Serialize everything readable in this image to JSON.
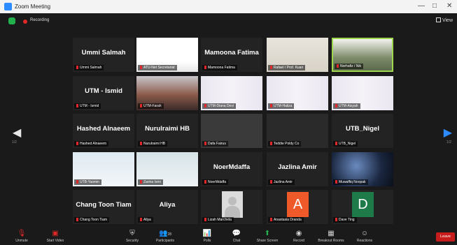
{
  "window": {
    "title": "Zoom Meeting",
    "minimize": "—",
    "maximize": "□",
    "close": "✕"
  },
  "status": {
    "recording": "Recording",
    "view": "View"
  },
  "nav": {
    "prev_page": "1/2",
    "next_page": "1/2"
  },
  "tiles": [
    {
      "name": "Ummi Salmah",
      "label": "Ummi Salmah",
      "type": "name"
    },
    {
      "name": "",
      "label": "ATU-Net Secretariat",
      "type": "video"
    },
    {
      "name": "Mamoona Fatima",
      "label": "Mamoona Fatima",
      "type": "name"
    },
    {
      "name": "",
      "label": "Rafael / Prof. Kuan",
      "type": "video"
    },
    {
      "name": "",
      "label": "Norhafiz / Nik",
      "type": "video"
    },
    {
      "name": "UTM - Ismid",
      "label": "UTM - Ismid",
      "type": "name"
    },
    {
      "name": "",
      "label": "UTM-Farah",
      "type": "video"
    },
    {
      "name": "",
      "label": "UTM-Diana Devi",
      "type": "video"
    },
    {
      "name": "",
      "label": "UTM-Haliza",
      "type": "video"
    },
    {
      "name": "",
      "label": "UTM-Aisyah",
      "type": "video"
    },
    {
      "name": "Hashed Alnaeem",
      "label": "Hashed Alnaeem",
      "type": "name"
    },
    {
      "name": "Nurulraimi HB",
      "label": "Nurulraimi HB",
      "type": "name"
    },
    {
      "name": "",
      "label": "Dafa Fairus",
      "type": "video"
    },
    {
      "name": "",
      "label": "Teddie Poldy Co",
      "type": "video"
    },
    {
      "name": "UTB_Nigel",
      "label": "UTB_Nigel",
      "type": "name"
    },
    {
      "name": "",
      "label": "UTB-Yasmin",
      "type": "video"
    },
    {
      "name": "",
      "label": "Zarina Ismi",
      "type": "video"
    },
    {
      "name": "NoerMdaffa",
      "label": "NoerMdaffa",
      "type": "name"
    },
    {
      "name": "Jazlina Amir",
      "label": "Jazlina Amir",
      "type": "name"
    },
    {
      "name": "",
      "label": "Muwaffiq Noopak",
      "type": "video"
    },
    {
      "name": "Chang Toon Tiam",
      "label": "Chang Toon Tiam",
      "type": "name"
    },
    {
      "name": "Aliya",
      "label": "Aliya",
      "type": "name"
    },
    {
      "name": "",
      "label": "Lizah Marchela",
      "type": "avatar"
    },
    {
      "name": "",
      "label": "Anastasia Dranda",
      "letter": "A",
      "color": "#f05a2b",
      "type": "letter"
    },
    {
      "name": "",
      "label": "Dave Ting",
      "letter": "D",
      "color": "#1f7a4a",
      "type": "letter"
    }
  ],
  "toolbar": {
    "unmute": "Unmute",
    "start_video": "Start Video",
    "security": "Security",
    "participants": "Participants",
    "participants_count": "28",
    "polls": "Polls",
    "chat": "Chat",
    "share_screen": "Share Screen",
    "record": "Record",
    "breakout_rooms": "Breakout Rooms",
    "reactions": "Reactions",
    "leave": "Leave"
  },
  "colors": {
    "active_speaker_border": "#9fd84d",
    "share_green": "#22b14c",
    "leave_red": "#c71c1c",
    "accent_blue": "#2d8cff"
  }
}
